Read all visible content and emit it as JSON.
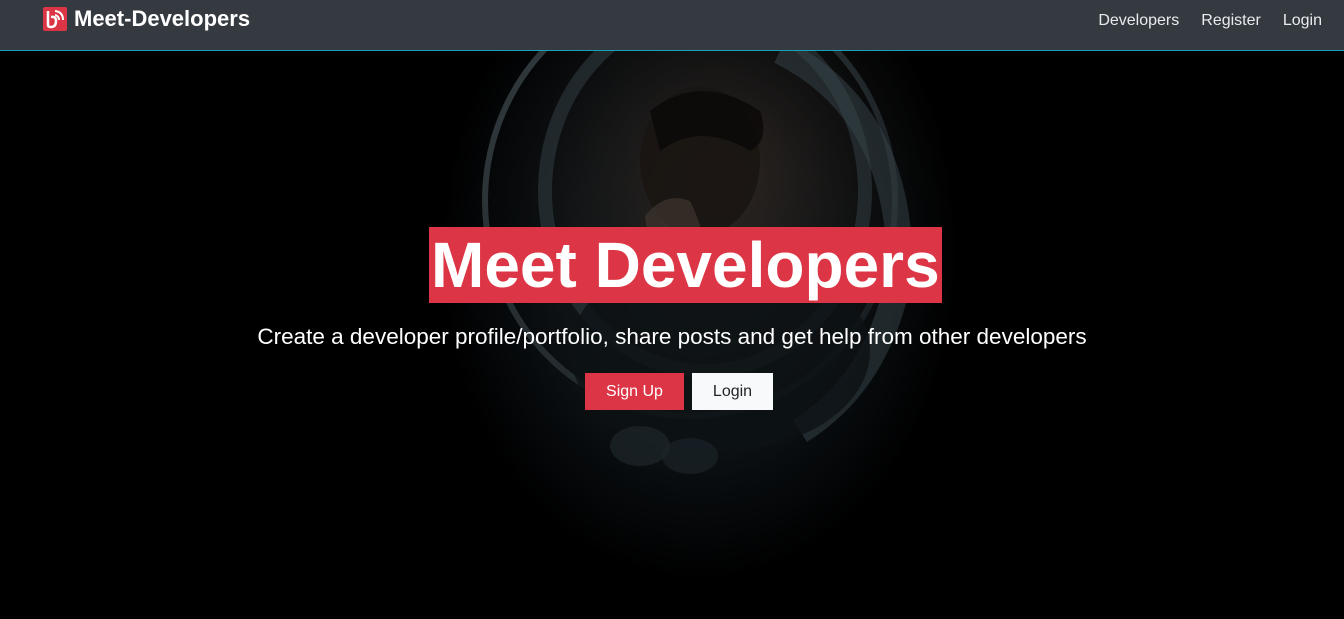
{
  "navbar": {
    "brand": "Meet-Developers",
    "brand_icon": "code-logo-icon",
    "links": [
      {
        "label": "Developers"
      },
      {
        "label": "Register"
      },
      {
        "label": "Login"
      }
    ]
  },
  "hero": {
    "title": "Meet Developers",
    "lead": "Create a developer profile/portfolio, share posts and get help from other developers",
    "signup_label": "Sign Up",
    "login_label": "Login",
    "background_image": "astronaut-helmet-image"
  },
  "colors": {
    "navbar_bg": "#343a40",
    "accent": "#dc3545",
    "light": "#f8f9fa"
  }
}
